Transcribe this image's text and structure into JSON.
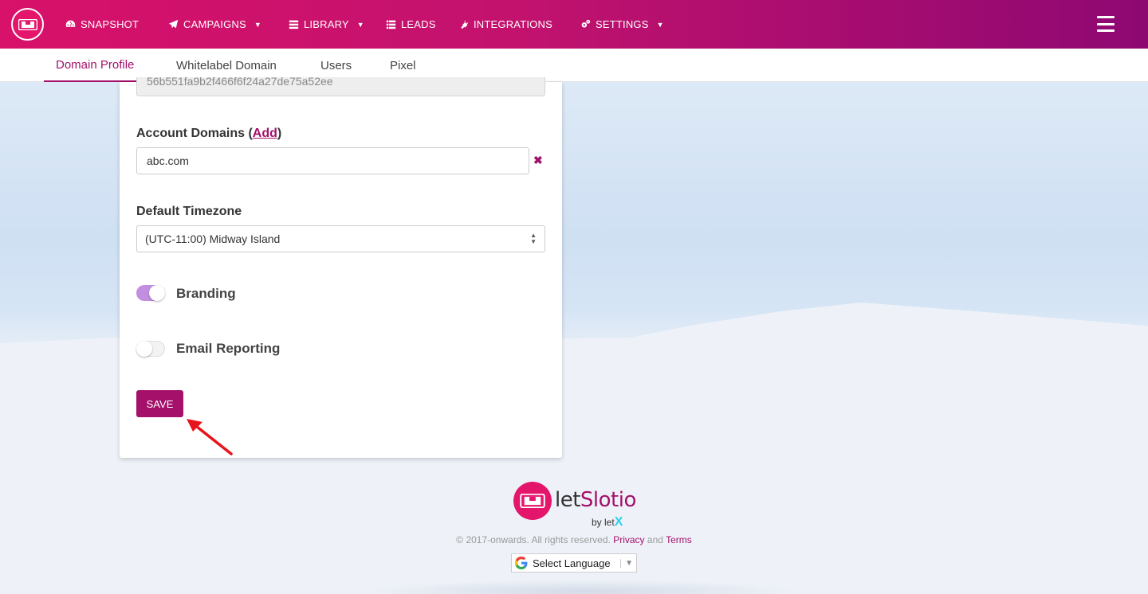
{
  "nav": {
    "items": [
      {
        "label": "SNAPSHOT",
        "icon": "dashboard-icon",
        "has_caret": false
      },
      {
        "label": "CAMPAIGNS",
        "icon": "paper-plane-icon",
        "has_caret": true
      },
      {
        "label": "LIBRARY",
        "icon": "library-icon",
        "has_caret": true
      },
      {
        "label": "LEADS",
        "icon": "list-icon",
        "has_caret": false
      },
      {
        "label": "INTEGRATIONS",
        "icon": "plug-icon",
        "has_caret": false
      },
      {
        "label": "SETTINGS",
        "icon": "cogs-icon",
        "has_caret": true
      }
    ],
    "caret": "▼"
  },
  "subnav": {
    "tabs": [
      {
        "label": "Domain Profile",
        "active": true
      },
      {
        "label": "Whitelabel Domain",
        "active": false
      },
      {
        "label": "Users",
        "active": false
      },
      {
        "label": "Pixel",
        "active": false
      }
    ]
  },
  "form": {
    "readonly_value": "56b551fa9b2f466f6f24a27de75a52ee",
    "account_domains_label": "Account Domains (",
    "account_domains_add": "Add",
    "account_domains_close": ")",
    "domain_value": "abc.com",
    "remove_glyph": "✖",
    "timezone_label": "Default Timezone",
    "timezone_value": "(UTC-11:00) Midway Island",
    "branding_label": "Branding",
    "branding_on": true,
    "email_reporting_label": "Email Reporting",
    "email_reporting_on": false,
    "save_label": "SAVE"
  },
  "footer": {
    "brand_prefix": "let",
    "brand_suffix": "Slotio",
    "brand_by": "by let",
    "brand_x": "X",
    "copyright": "© 2017-onwards. All rights reserved.",
    "privacy": "Privacy",
    "and": "and",
    "terms": "Terms",
    "language": "Select Language",
    "language_caret": "▼"
  },
  "colors": {
    "brand": "#a4106a",
    "nav_start": "#d8116a",
    "nav_end": "#8e0872",
    "toggle_on": "#c28fe0",
    "annotation_arrow": "#e8141c"
  }
}
